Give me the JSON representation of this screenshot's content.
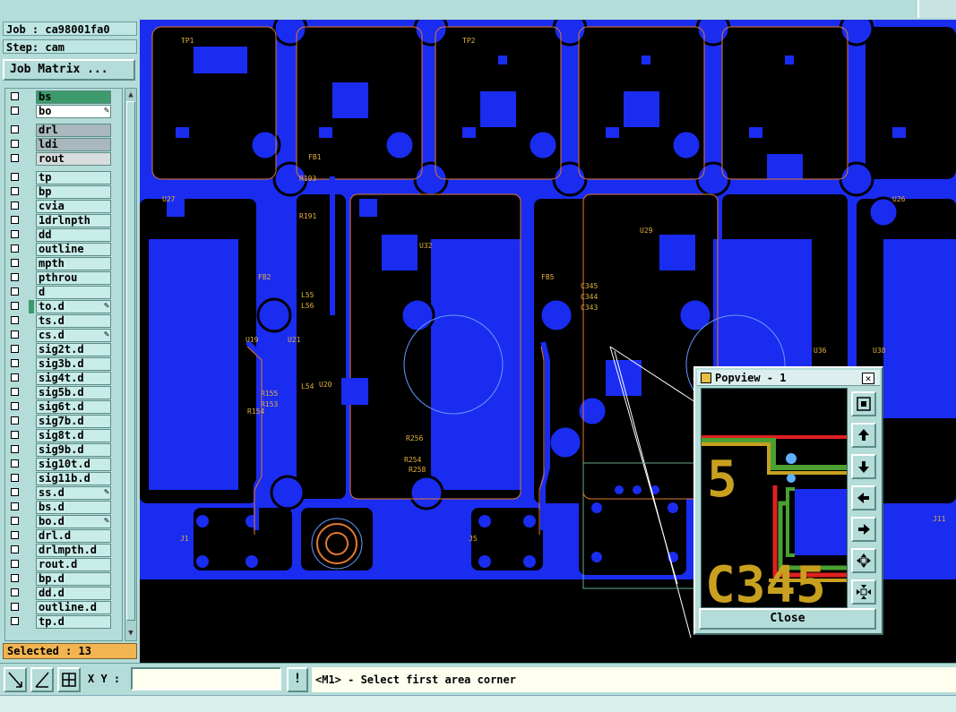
{
  "job": {
    "job_label": "Job : ca98001fa0",
    "step_label": "Step: cam",
    "matrix_button": "Job Matrix ..."
  },
  "layers": [
    {
      "name": "bs",
      "style": "green",
      "edit": "",
      "mark": false
    },
    {
      "name": "bo",
      "style": "white",
      "edit": "✎",
      "mark": false
    },
    {
      "name": "drl",
      "style": "grey",
      "edit": "",
      "mark": false
    },
    {
      "name": "ldi",
      "style": "grey",
      "edit": "",
      "mark": false
    },
    {
      "name": "rout",
      "style": "lightgrey",
      "edit": "",
      "mark": false
    },
    {
      "name": "tp",
      "style": "",
      "edit": "",
      "mark": false
    },
    {
      "name": "bp",
      "style": "",
      "edit": "",
      "mark": false
    },
    {
      "name": "cvia",
      "style": "",
      "edit": "",
      "mark": false
    },
    {
      "name": "1drlnpth",
      "style": "",
      "edit": "",
      "mark": false
    },
    {
      "name": "dd",
      "style": "",
      "edit": "",
      "mark": false
    },
    {
      "name": "outline",
      "style": "",
      "edit": "",
      "mark": false
    },
    {
      "name": "mpth",
      "style": "",
      "edit": "",
      "mark": false
    },
    {
      "name": "pthrou",
      "style": "",
      "edit": "",
      "mark": false
    },
    {
      "name": "d",
      "style": "",
      "edit": "",
      "mark": false
    },
    {
      "name": "to.d",
      "style": "",
      "edit": "✎",
      "mark": true
    },
    {
      "name": "ts.d",
      "style": "",
      "edit": "",
      "mark": false
    },
    {
      "name": "cs.d",
      "style": "",
      "edit": "✎",
      "mark": false
    },
    {
      "name": "sig2t.d",
      "style": "",
      "edit": "",
      "mark": false
    },
    {
      "name": "sig3b.d",
      "style": "",
      "edit": "",
      "mark": false
    },
    {
      "name": "sig4t.d",
      "style": "",
      "edit": "",
      "mark": false
    },
    {
      "name": "sig5b.d",
      "style": "",
      "edit": "",
      "mark": false
    },
    {
      "name": "sig6t.d",
      "style": "",
      "edit": "",
      "mark": false
    },
    {
      "name": "sig7b.d",
      "style": "",
      "edit": "",
      "mark": false
    },
    {
      "name": "sig8t.d",
      "style": "",
      "edit": "",
      "mark": false
    },
    {
      "name": "sig9b.d",
      "style": "",
      "edit": "",
      "mark": false
    },
    {
      "name": "sig10t.d",
      "style": "",
      "edit": "",
      "mark": false
    },
    {
      "name": "sig11b.d",
      "style": "",
      "edit": "",
      "mark": false
    },
    {
      "name": "ss.d",
      "style": "",
      "edit": "✎",
      "mark": false
    },
    {
      "name": "bs.d",
      "style": "",
      "edit": "",
      "mark": false
    },
    {
      "name": "bo.d",
      "style": "",
      "edit": "✎",
      "mark": false
    },
    {
      "name": "drl.d",
      "style": "",
      "edit": "",
      "mark": false
    },
    {
      "name": "drlmpth.d",
      "style": "",
      "edit": "",
      "mark": false
    },
    {
      "name": "rout.d",
      "style": "",
      "edit": "",
      "mark": false
    },
    {
      "name": "bp.d",
      "style": "",
      "edit": "",
      "mark": false
    },
    {
      "name": "dd.d",
      "style": "",
      "edit": "",
      "mark": false
    },
    {
      "name": "outline.d",
      "style": "",
      "edit": "",
      "mark": false
    },
    {
      "name": "tp.d",
      "style": "",
      "edit": "",
      "mark": false
    }
  ],
  "selected_label": "Selected : 13",
  "bottom": {
    "xy_label": "X Y :",
    "xy_value": "",
    "warn_label": "!",
    "message": "<M1> - Select first area corner"
  },
  "popview": {
    "title": "Popview - 1",
    "close_label": "Close",
    "view_text_5": "5",
    "view_text_c345": "C345"
  },
  "board_labels": [
    "J1",
    "J5",
    "J11",
    "U19",
    "U20",
    "U21",
    "U32",
    "U36",
    "U38",
    "R154",
    "R155",
    "R153",
    "C345",
    "C344",
    "C343",
    "L55",
    "L56",
    "L54",
    "R193",
    "R191",
    "FB1",
    "FB2",
    "FB5",
    "TP1",
    "TP2",
    "U27",
    "U26",
    "U29",
    "R256",
    "R254",
    "R258"
  ],
  "colors": {
    "board_blue": "#1a2cf0",
    "panel_bg": "#b4dcd8",
    "silk_orange": "#e07830",
    "selected_orange": "#f2b450",
    "trace_green": "#4aa030",
    "trace_gold": "#c8a020"
  }
}
